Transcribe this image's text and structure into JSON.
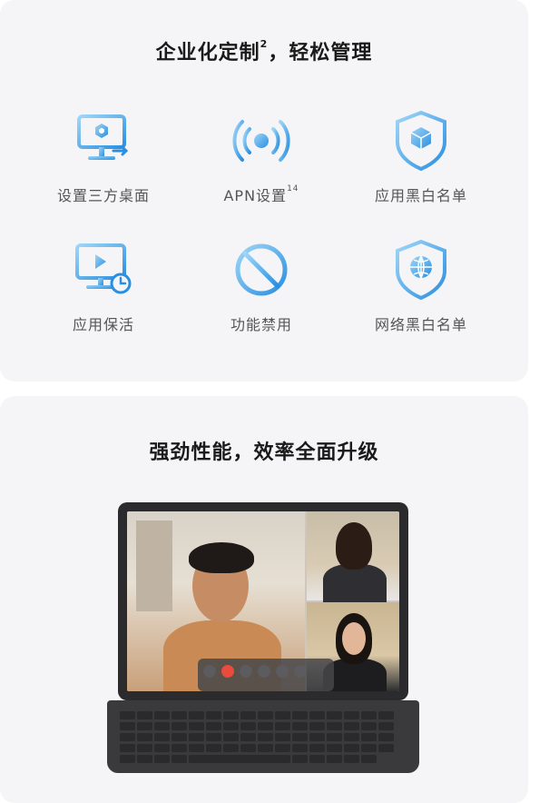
{
  "section1": {
    "title": "企业化定制",
    "title_sup": "2",
    "title_rest": "，轻松管理",
    "features": [
      {
        "icon": "custom-desktop-icon",
        "label": "设置三方桌面",
        "sup": ""
      },
      {
        "icon": "apn-signal-icon",
        "label": "APN设置",
        "sup": "14"
      },
      {
        "icon": "app-whitelist-shield-icon",
        "label": "应用黑白名单",
        "sup": ""
      },
      {
        "icon": "app-keepalive-icon",
        "label": "应用保活",
        "sup": ""
      },
      {
        "icon": "function-disable-icon",
        "label": "功能禁用",
        "sup": ""
      },
      {
        "icon": "network-whitelist-shield-icon",
        "label": "网络黑白名单",
        "sup": ""
      }
    ]
  },
  "section2": {
    "title": "强劲性能，效率全面升级"
  },
  "colors": {
    "icon_light": "#7ec4f0",
    "icon_dark": "#1e88e5",
    "card_bg": "#f5f5f7"
  }
}
